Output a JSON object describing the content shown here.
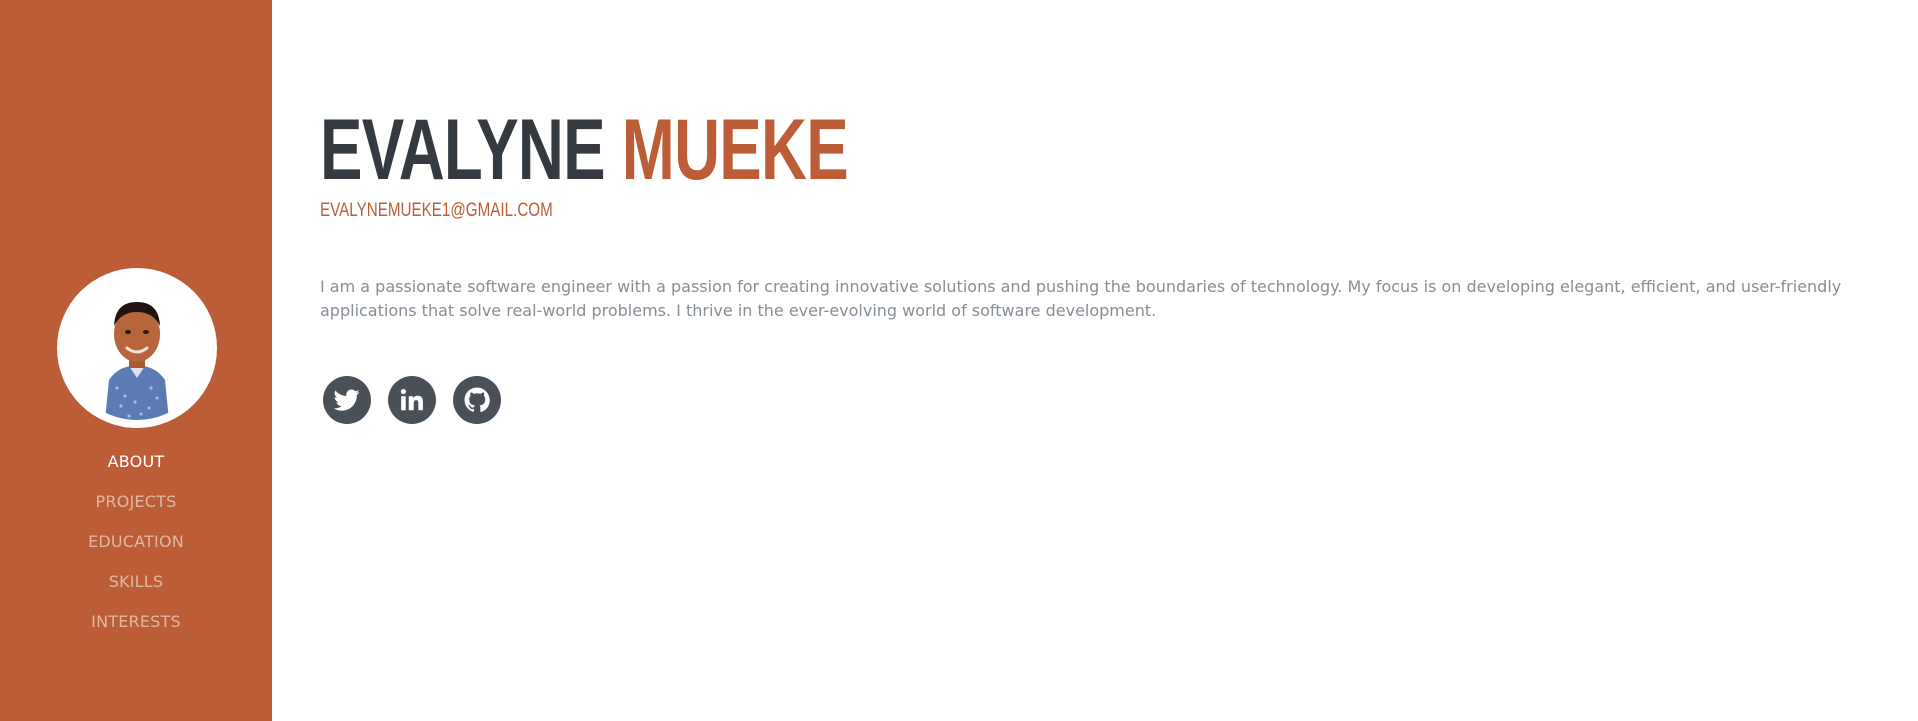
{
  "profile": {
    "first_name": "EVALYNE",
    "last_name": "MUEKE",
    "email": "EVALYNEMUEKE1@GMAIL.COM",
    "about": "I am a passionate software engineer with a passion for creating innovative solutions and pushing the boundaries of technology. My focus is on developing elegant, efficient, and user-friendly applications that solve real-world problems. I thrive in the ever-evolving world of software development."
  },
  "nav": {
    "items": [
      {
        "label": "ABOUT",
        "active": true
      },
      {
        "label": "PROJECTS",
        "active": false
      },
      {
        "label": "EDUCATION",
        "active": false
      },
      {
        "label": "SKILLS",
        "active": false
      },
      {
        "label": "INTERESTS",
        "active": false
      }
    ]
  },
  "socials": [
    {
      "icon": "twitter-icon"
    },
    {
      "icon": "linkedin-icon"
    },
    {
      "icon": "github-icon"
    }
  ],
  "colors": {
    "primary": "#bd5d38",
    "heading": "#343a40",
    "text_muted": "#868e96",
    "social_bg": "#495057"
  }
}
